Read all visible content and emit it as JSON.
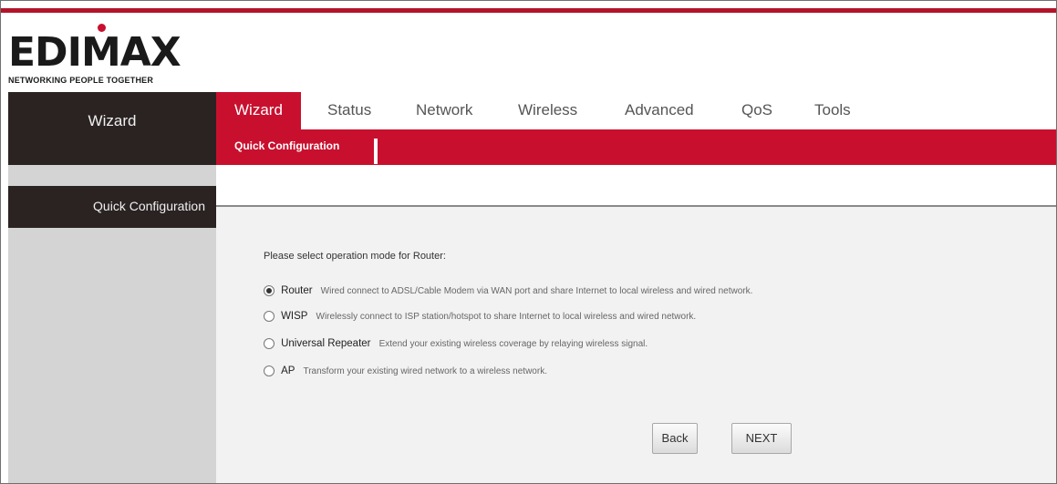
{
  "brand": {
    "logo_text": "EDIMAX",
    "tagline": "NETWORKING PEOPLE TOGETHER",
    "accent": "#c8102e",
    "dark": "#2a2322"
  },
  "sidebar": {
    "header": "Wizard",
    "items": [
      {
        "label": "Quick Configuration"
      }
    ]
  },
  "nav": {
    "tabs": [
      {
        "label": "Wizard",
        "active": true
      },
      {
        "label": "Status"
      },
      {
        "label": "Network"
      },
      {
        "label": "Wireless"
      },
      {
        "label": "Advanced"
      },
      {
        "label": "QoS"
      },
      {
        "label": "Tools"
      }
    ],
    "subtabs": [
      {
        "label": "Quick Configuration"
      }
    ]
  },
  "main": {
    "prompt": "Please select operation mode for Router:",
    "options": [
      {
        "name": "Router",
        "desc": "Wired connect to ADSL/Cable Modem via WAN port and share Internet to local wireless and wired network.",
        "checked": true
      },
      {
        "name": "WISP",
        "desc": "Wirelessly connect to ISP station/hotspot to share Internet to local wireless and wired network."
      },
      {
        "name": "Universal Repeater",
        "desc": "Extend your existing wireless coverage by relaying wireless signal."
      },
      {
        "name": "AP",
        "desc": "Transform your existing wired network to a wireless network."
      }
    ],
    "buttons": {
      "back": "Back",
      "next": "NEXT"
    }
  }
}
